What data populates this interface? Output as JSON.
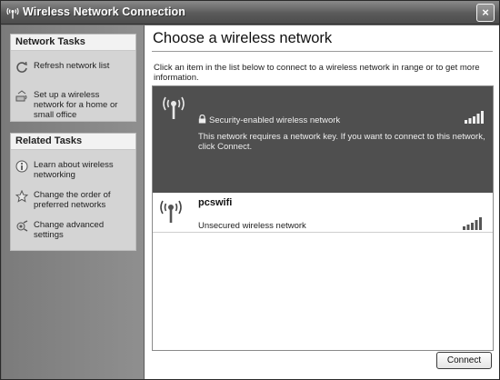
{
  "window": {
    "title": "Wireless Network Connection",
    "close_label": "×"
  },
  "network_tasks": {
    "header": "Network Tasks",
    "items": [
      {
        "label": "Refresh network list",
        "icon": "refresh-icon"
      },
      {
        "label": "Set up a wireless network for a home or small office",
        "icon": "setup-network-icon"
      }
    ]
  },
  "related_tasks": {
    "header": "Related Tasks",
    "items": [
      {
        "label": "Learn about wireless networking",
        "icon": "info-icon"
      },
      {
        "label": "Change the order of preferred networks",
        "icon": "star-icon"
      },
      {
        "label": "Change advanced settings",
        "icon": "settings-icon"
      }
    ]
  },
  "main": {
    "heading": "Choose a wireless network",
    "instructions": "Click an item in the list below to connect to a wireless network in range or to get more information."
  },
  "networks": [
    {
      "name": "",
      "security": "Security-enabled wireless network",
      "message": "This network requires a network key. If you want to connect to this network, click Connect.",
      "selected": true,
      "signal_bars": 5
    },
    {
      "name": "pcswifi",
      "security": "Unsecured wireless network",
      "selected": false,
      "signal_bars": 5
    }
  ],
  "buttons": {
    "connect": "Connect"
  },
  "colors": {
    "selected_row": "#4f4f4f",
    "title_bar": "#5a5a5a",
    "left_pane": "#858585"
  }
}
